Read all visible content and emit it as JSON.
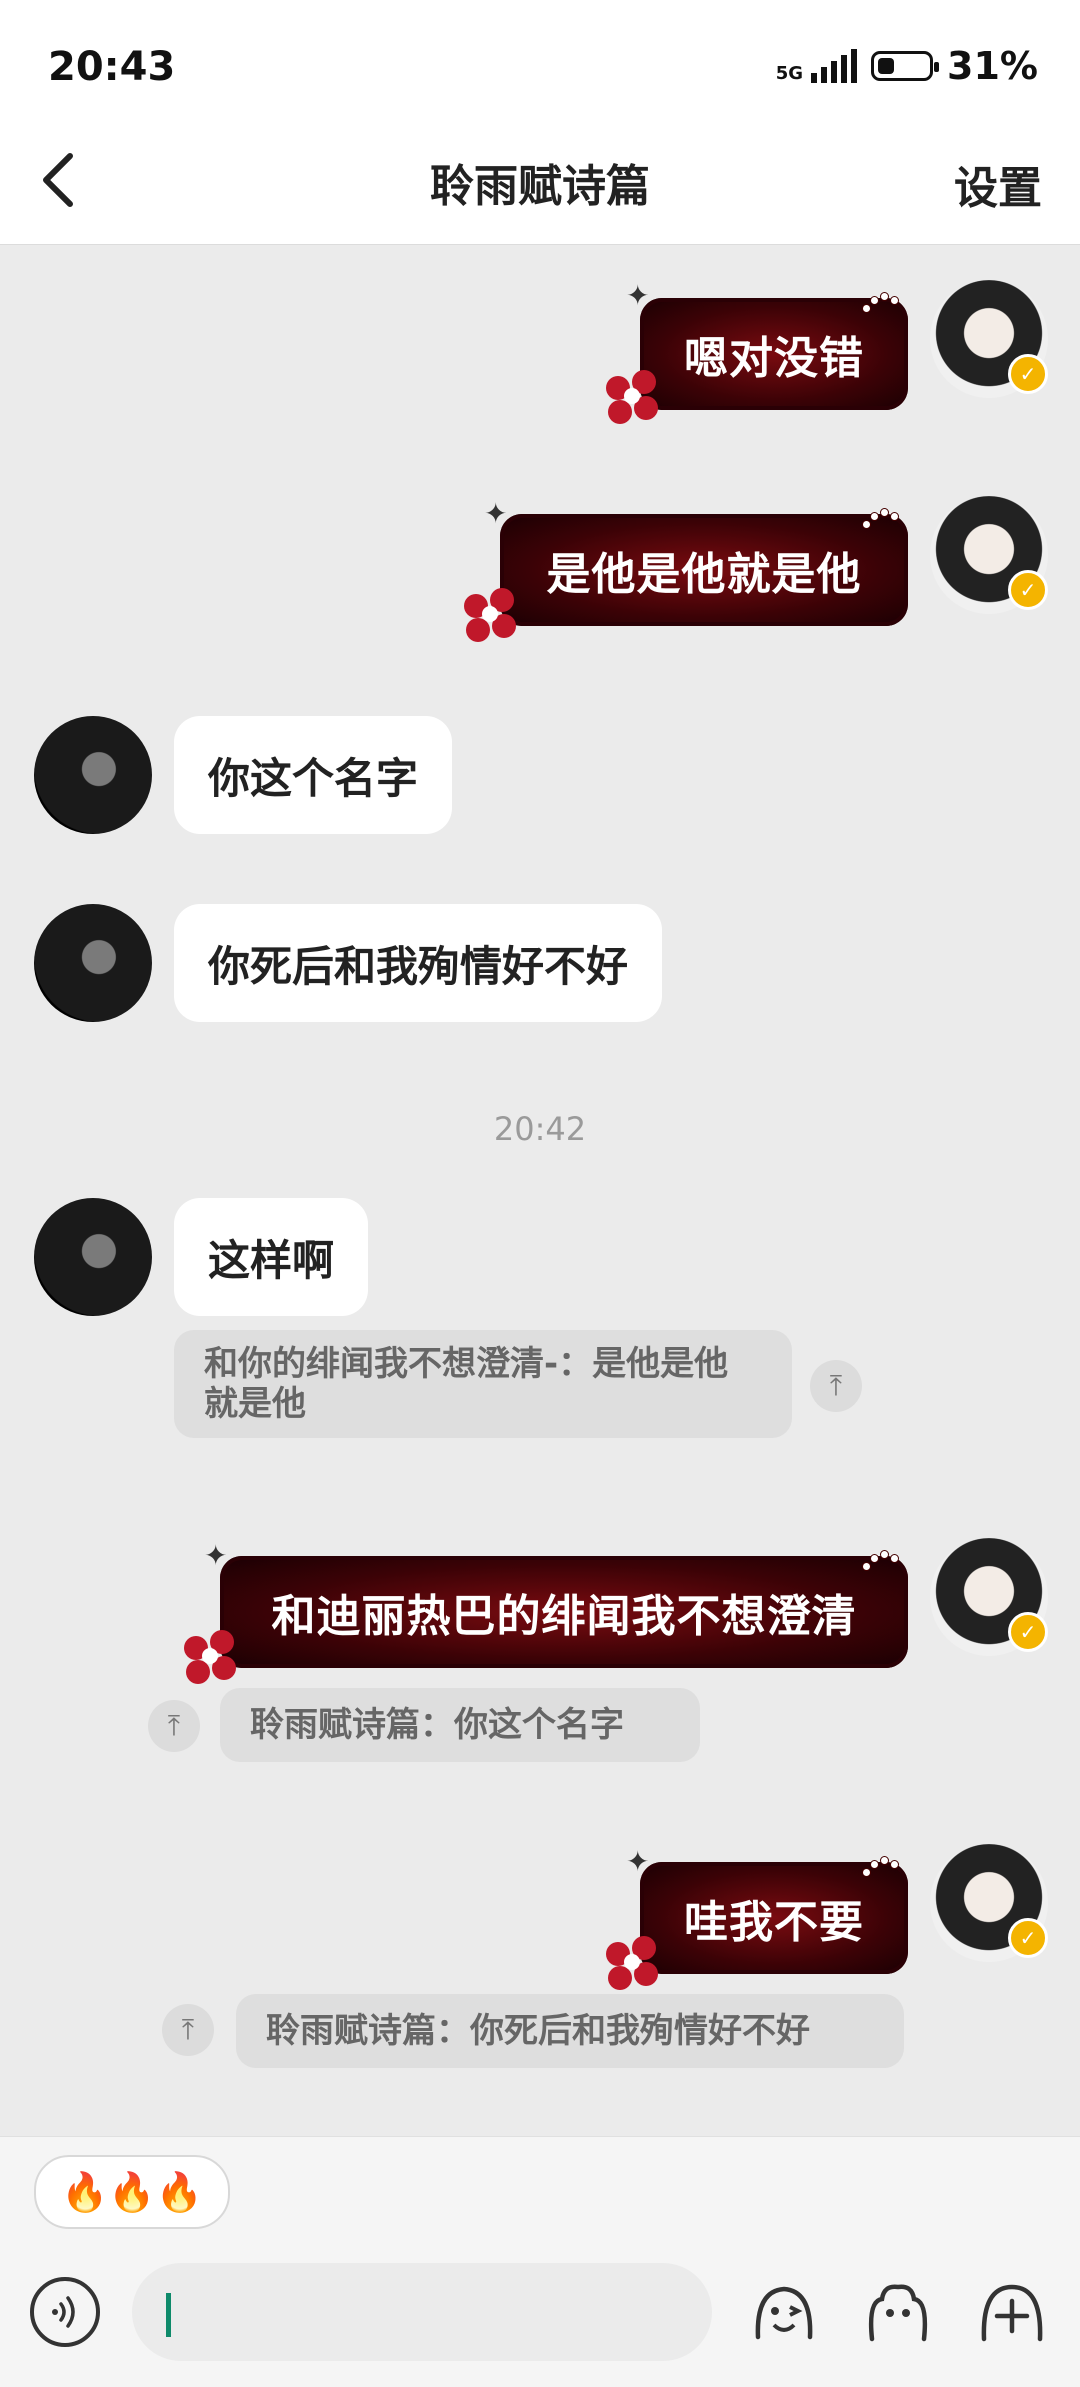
{
  "status_bar": {
    "time": "20:43",
    "network": "5G",
    "battery": "31%",
    "battery_level": 0.31
  },
  "header": {
    "title": "聆雨赋诗篇",
    "settings_label": "设置"
  },
  "messages": {
    "m1": "嗯对没错",
    "m2": "是他是他就是他",
    "m3": "你这个名字",
    "m4": "你死后和我殉情好不好",
    "timestamp": "20:42",
    "m5": "这样啊",
    "q1": "和你的绯闻我不想澄清-：是他是他就是他",
    "m6": "和迪丽热巴的绯闻我不想澄清",
    "q2": "聆雨赋诗篇：你这个名字",
    "m7": "哇我不要",
    "q3": "聆雨赋诗篇：你死后和我殉情好不好"
  },
  "bottom": {
    "quick_reply": "🔥🔥🔥",
    "input_value": ""
  },
  "icons": [
    "back-icon",
    "voice-icon",
    "emoji-face-icon",
    "sticker-icon",
    "add-icon",
    "quote-up-icon",
    "verified-badge-icon"
  ],
  "colors": {
    "bubble_dark_red": "#5a0509",
    "badge": "#f4b400",
    "caret": "#0e8a6a"
  }
}
